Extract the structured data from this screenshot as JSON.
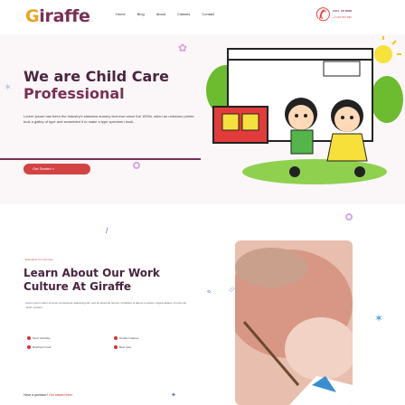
{
  "header": {
    "logo": "Giraffe",
    "logo_accent_letter": "G",
    "nav": [
      "Home",
      "Blog",
      "About",
      "Classes",
      "Contact"
    ],
    "phone_label": "CALL US NOW",
    "phone_number": "+1 234 567 890"
  },
  "hero": {
    "title_line1": "We are Child Care",
    "title_line2": "Professional",
    "text": "Lorem Ipsum has been the industry's standard dummy text ever since the 1500s, when an unknown printer took a galley of type and scrambled it to make a type specimen book.",
    "cta": "Get Started »"
  },
  "about": {
    "kicker": "Education for everyone",
    "title": "Learn About Our Work Culture At Giraffe",
    "text": "Lorem ipsum dolor sit amet consectetur adipiscing elit, sed do eiusmod tempor incididunt ut labore et dolore magna aliqua. Ut enim ad minim veniam.",
    "features": [
      "Sport Activities",
      "Outdoor Games",
      "Nutritious Food",
      "Best Care"
    ],
    "question": "Have a question?",
    "question_link": "Get started free»"
  },
  "colors": {
    "brand": "#7a2f55",
    "accent": "#d34343",
    "logo_yellow": "#e9a520",
    "hero_bg": "#fbf7f9"
  }
}
